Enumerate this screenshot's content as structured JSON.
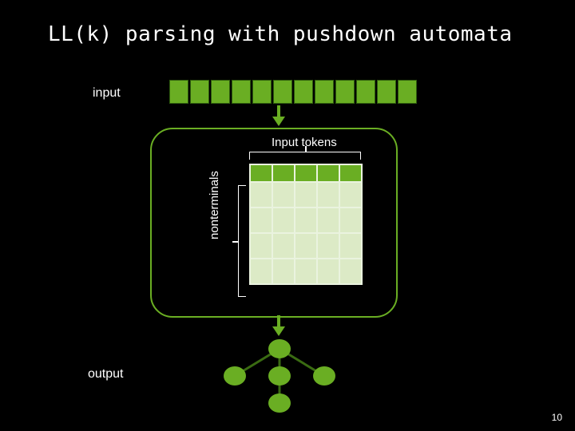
{
  "title": "LL(k) parsing with pushdown automata",
  "labels": {
    "input": "input",
    "output": "output",
    "input_tokens": "Input tokens",
    "nonterminals": "nonterminals"
  },
  "slide_number": "10",
  "colors": {
    "accent": "#6aae23",
    "bg": "#000000",
    "text": "#ffffff",
    "table_cell": "#dceac6",
    "table_bg": "#eaf3df"
  },
  "chart_data": {
    "type": "table",
    "input_tape_cells": 12,
    "parse_table": {
      "columns": 5,
      "rows": 5,
      "col_label": "Input tokens",
      "row_label": "nonterminals"
    },
    "tree": {
      "nodes": 5,
      "edges": [
        [
          0,
          1
        ],
        [
          0,
          2
        ],
        [
          0,
          3
        ],
        [
          2,
          4
        ]
      ]
    }
  }
}
